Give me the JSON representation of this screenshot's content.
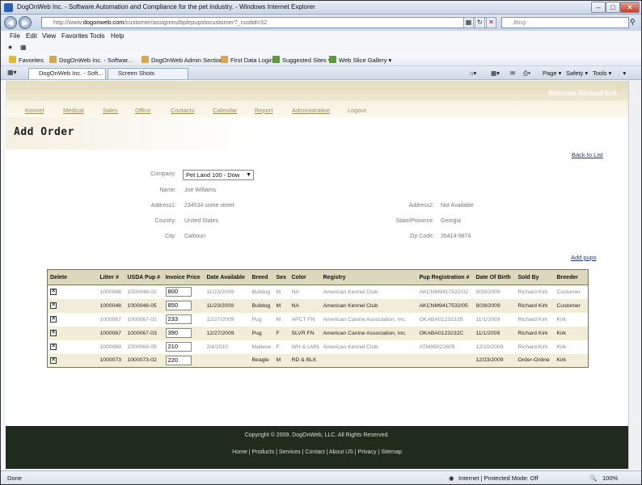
{
  "window": {
    "title": "DogOnWeb Inc. - Software Automation and Compliance for the pet industry. - Windows Internet Explorer"
  },
  "address": {
    "prefix": "http://www.",
    "domain": "dogonweb.com",
    "path": "/customer/assignmultiplepupstocustomer?_custid=32",
    "search_placeholder": "Bing"
  },
  "menu": [
    "File",
    "Edit",
    "View",
    "Favorites",
    "Tools",
    "Help"
  ],
  "favorites": {
    "label": "Favorites",
    "items": [
      "DogOnWeb Inc. - Softwar...",
      "DogOnWeb Admin Section",
      "First Data Login",
      "Suggested Sites ▾",
      "Web Slice Gallery ▾"
    ]
  },
  "tabs": [
    "DogOnWeb Inc. - Soft...",
    "Screen Shots"
  ],
  "commands": [
    "Page ▾",
    "Safety ▾",
    "Tools ▾"
  ],
  "header": {
    "welcome": "Welcome Richard Kirk"
  },
  "nav": [
    "Kennel",
    "Medical",
    "Sales",
    "Office",
    "Contacts",
    "Calendar",
    "Report",
    "Administrative",
    "Logout"
  ],
  "page": {
    "title": "Add Order",
    "back_link": "Back to List",
    "add_pups": "Add pups"
  },
  "form": {
    "company_label": "Company:",
    "company_value": "Pet Land 100 - Dow",
    "name_label": "Name:",
    "name_value": "Joe Williams",
    "address1_label": "Address1:",
    "address1_value": "234534 some street",
    "address2_label": "Address2:",
    "address2_value": "Not Available",
    "country_label": "Country:",
    "country_value": "United States",
    "state_label": "State/Province:",
    "state_value": "Georgia",
    "city_label": "City:",
    "city_value": "Calhoun",
    "zip_label": "Zip Code:",
    "zip_value": "35414-9874"
  },
  "table": {
    "headers": [
      "Delete",
      "Litter #",
      "USDA Pup #",
      "Invoice Price",
      "Date Available",
      "Breed",
      "Sex",
      "Color",
      "Registry",
      "Pup Registration #",
      "Date Of Birth",
      "Sold By",
      "Breeder"
    ],
    "rows": [
      [
        "1000048",
        "1000048-02",
        "800",
        "11/23/2009",
        "Bulldog",
        "M",
        "NA",
        "American Kennel Club",
        "AKCNM9417532/02",
        "9/28/2009",
        "Richard Kirk",
        "Customer"
      ],
      [
        "1000048",
        "1000048-05",
        "850",
        "11/23/2009",
        "Bulldog",
        "M",
        "NA",
        "American Kennel Club",
        "AKCNM9417532/05",
        "9/28/2009",
        "Richard Kirk",
        "Customer"
      ],
      [
        "1000067",
        "1000067-02",
        "233",
        "12/27/2009",
        "Pug",
        "M",
        "APCT FN",
        "American Canine Association, Inc.",
        "OKABA0123232B",
        "11/1/2009",
        "Richard Kirk",
        "Kirk"
      ],
      [
        "1000067",
        "1000067-03",
        "390",
        "12/27/2009",
        "Pug",
        "F",
        "SLVR FN",
        "American Canine Association, Inc.",
        "OKABA0123232C",
        "11/1/2009",
        "Richard Kirk",
        "Kirk"
      ],
      [
        "1000069",
        "1000069-05",
        "210",
        "2/4/2010",
        "Maltese",
        "F",
        "WH & LMN",
        "American Kennel Club",
        "ATM95022605",
        "12/10/2009",
        "Richard Kirk",
        "Kirk"
      ],
      [
        "1000073",
        "1000073-02",
        "220",
        "",
        "Beagle",
        "M",
        "RD & BLK",
        "",
        "",
        "12/23/2009",
        "Order-Online",
        "Kirk"
      ]
    ]
  },
  "footer": {
    "copyright": "Copyright © 2009.  DogOnWeb, LLC.  All Rights Reserved.",
    "links": [
      "Home",
      "Products",
      "Services",
      "Contact",
      "About US",
      "Privacy",
      "Sitemap"
    ]
  },
  "status": {
    "left": "Done",
    "zone": "Internet | Protected Mode: Off",
    "zoom": "100%"
  }
}
